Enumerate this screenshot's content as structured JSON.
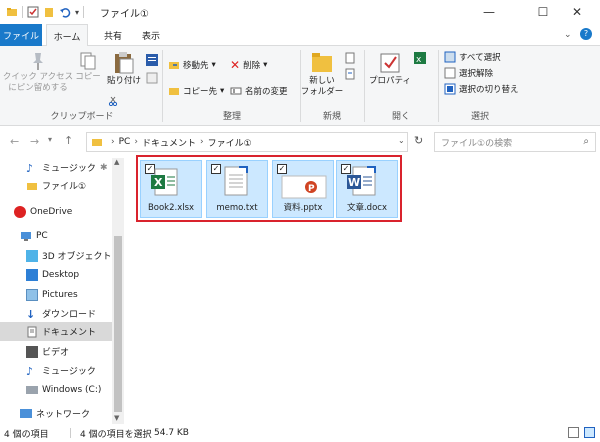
{
  "window": {
    "title": "ファイル①"
  },
  "tabs": [
    {
      "label": "ファイル"
    },
    {
      "label": "ホーム"
    },
    {
      "label": "共有"
    },
    {
      "label": "表示"
    }
  ],
  "ribbon": {
    "clipboard": {
      "label": "クリップボード",
      "pin": "クイック アクセス\nにピン留めする",
      "copy": "コピー",
      "paste": "貼り付け"
    },
    "organize": {
      "label": "整理",
      "move": "移動先",
      "copyto": "コピー先",
      "delete": "削除",
      "rename": "名前の変更"
    },
    "new": {
      "label": "新規",
      "folder": "新しい\nフォルダー"
    },
    "open": {
      "label": "開く",
      "props": "プロパティ"
    },
    "select": {
      "label": "選択",
      "all": "すべて選択",
      "none": "選択解除",
      "invert": "選択の切り替え"
    }
  },
  "address": {
    "path": [
      "PC",
      "ドキュメント",
      "ファイル①"
    ],
    "search_placeholder": "ファイル①の検索"
  },
  "nav": {
    "items": [
      {
        "label": "ミュージック"
      },
      {
        "label": "ファイル①"
      },
      {
        "label": "OneDrive"
      },
      {
        "label": "PC"
      },
      {
        "label": "3D オブジェクト"
      },
      {
        "label": "Desktop"
      },
      {
        "label": "Pictures"
      },
      {
        "label": "ダウンロード"
      },
      {
        "label": "ドキュメント"
      },
      {
        "label": "ビデオ"
      },
      {
        "label": "ミュージック"
      },
      {
        "label": "Windows (C:)"
      },
      {
        "label": "ネットワーク"
      }
    ]
  },
  "files": [
    {
      "name": "Book2.xlsx",
      "icon": "excel-file-icon"
    },
    {
      "name": "memo.txt",
      "icon": "text-file-icon"
    },
    {
      "name": "資料.pptx",
      "icon": "powerpoint-file-icon"
    },
    {
      "name": "文章.docx",
      "icon": "word-file-icon"
    }
  ],
  "status": {
    "count": "4 個の項目",
    "selected": "4 個の項目を選択",
    "size": "54.7 KB"
  },
  "colors": {
    "accent": "#1979ca",
    "selection": "#cce8ff",
    "highlight_frame": "#d9232d"
  }
}
